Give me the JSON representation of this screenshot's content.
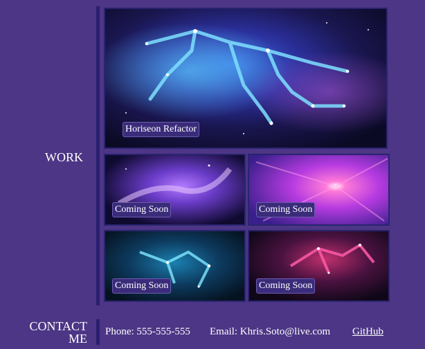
{
  "work": {
    "title": "WORK",
    "projects": [
      {
        "label": "Horiseon Refactor"
      },
      {
        "label": "Coming Soon"
      },
      {
        "label": "Coming Soon"
      },
      {
        "label": "Coming Soon"
      },
      {
        "label": "Coming Soon"
      }
    ]
  },
  "contact": {
    "title": "CONTACT ME",
    "phone": "Phone: 555-555-555",
    "email": "Email: Khris.Soto@live.com",
    "github": "GitHub"
  },
  "colors": {
    "background": "#4c3685",
    "accent_bar": "#2a1e70",
    "label_bg": "#3a2c7a"
  },
  "images": [
    "gemini-constellation",
    "nebula-purple",
    "nebula-pink-burst",
    "constellation-cyan",
    "constellation-magenta"
  ]
}
